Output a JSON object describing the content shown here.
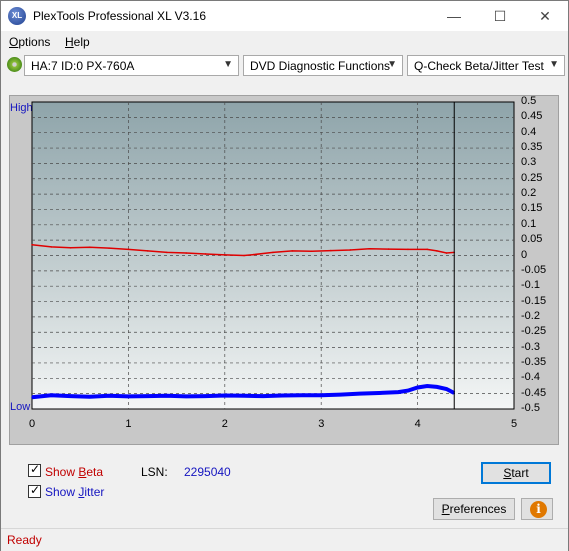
{
  "window": {
    "title": "PlexTools Professional XL V3.16",
    "app_icon_text": "XL",
    "minimize": "—",
    "maximize": "☐",
    "close": "✕"
  },
  "menu": {
    "options": "Options",
    "options_accel": "O",
    "options_rest": "ptions",
    "help_accel": "H",
    "help_rest": "elp"
  },
  "toolbar": {
    "drive": "HA:7 ID:0  PX-760A",
    "function": "DVD Diagnostic Functions",
    "test": "Q-Check Beta/Jitter Test"
  },
  "chart_data": {
    "type": "line",
    "xlim": [
      0,
      5
    ],
    "x_ticks": [
      "0",
      "1",
      "2",
      "3",
      "4",
      "5"
    ],
    "ylim": [
      -0.5,
      0.5
    ],
    "y_ticks": [
      "0.5",
      "0.45",
      "0.4",
      "0.35",
      "0.3",
      "0.25",
      "0.2",
      "0.15",
      "0.1",
      "0.05",
      "0",
      "-0.05",
      "-0.1",
      "-0.15",
      "-0.2",
      "-0.25",
      "-0.3",
      "-0.35",
      "-0.4",
      "-0.45",
      "-0.5"
    ],
    "left_axis_top": "High",
    "left_axis_bottom": "Low",
    "scan_end_x": 4.38,
    "series": [
      {
        "name": "Beta",
        "color": "#e00000",
        "x": [
          0,
          0.2,
          0.4,
          0.6,
          0.8,
          1.0,
          1.2,
          1.4,
          1.6,
          1.8,
          2.0,
          2.2,
          2.3,
          2.5,
          2.7,
          2.9,
          3.1,
          3.3,
          3.5,
          3.7,
          3.9,
          4.1,
          4.2,
          4.3,
          4.38
        ],
        "values": [
          0.035,
          0.028,
          0.025,
          0.027,
          0.024,
          0.02,
          0.015,
          0.01,
          0.008,
          0.005,
          0.002,
          0.0,
          0.003,
          0.01,
          0.015,
          0.014,
          0.016,
          0.018,
          0.022,
          0.021,
          0.02,
          0.02,
          0.015,
          0.008,
          0.01
        ]
      },
      {
        "name": "Jitter",
        "color": "#0000ff",
        "x": [
          0,
          0.2,
          0.4,
          0.6,
          0.8,
          1.0,
          1.2,
          1.4,
          1.6,
          1.8,
          2.0,
          2.2,
          2.4,
          2.6,
          2.8,
          3.0,
          3.2,
          3.4,
          3.6,
          3.8,
          3.9,
          4.0,
          4.1,
          4.2,
          4.3,
          4.38
        ],
        "values": [
          -0.462,
          -0.455,
          -0.458,
          -0.46,
          -0.457,
          -0.459,
          -0.458,
          -0.457,
          -0.459,
          -0.458,
          -0.456,
          -0.457,
          -0.458,
          -0.456,
          -0.455,
          -0.455,
          -0.453,
          -0.45,
          -0.448,
          -0.445,
          -0.44,
          -0.43,
          -0.425,
          -0.428,
          -0.435,
          -0.448
        ]
      }
    ]
  },
  "controls": {
    "show_beta_accel": "B",
    "show_beta_pre": "Show ",
    "show_beta_rest": "eta",
    "show_beta_checked": "✓",
    "show_jitter_pre": "Show ",
    "show_jitter_accel": "J",
    "show_jitter_rest": "itter",
    "show_jitter_checked": "✓",
    "lsn_label": "LSN:",
    "lsn_value": "2295040",
    "start_accel": "S",
    "start_rest": "tart",
    "preferences_accel": "P",
    "preferences_rest": "references",
    "info_icon": "i"
  },
  "status": {
    "text": "Ready"
  },
  "colors": {
    "beta_label": "#c00000",
    "jitter_label": "#1515c0",
    "lsn_value": "#1515c0"
  }
}
